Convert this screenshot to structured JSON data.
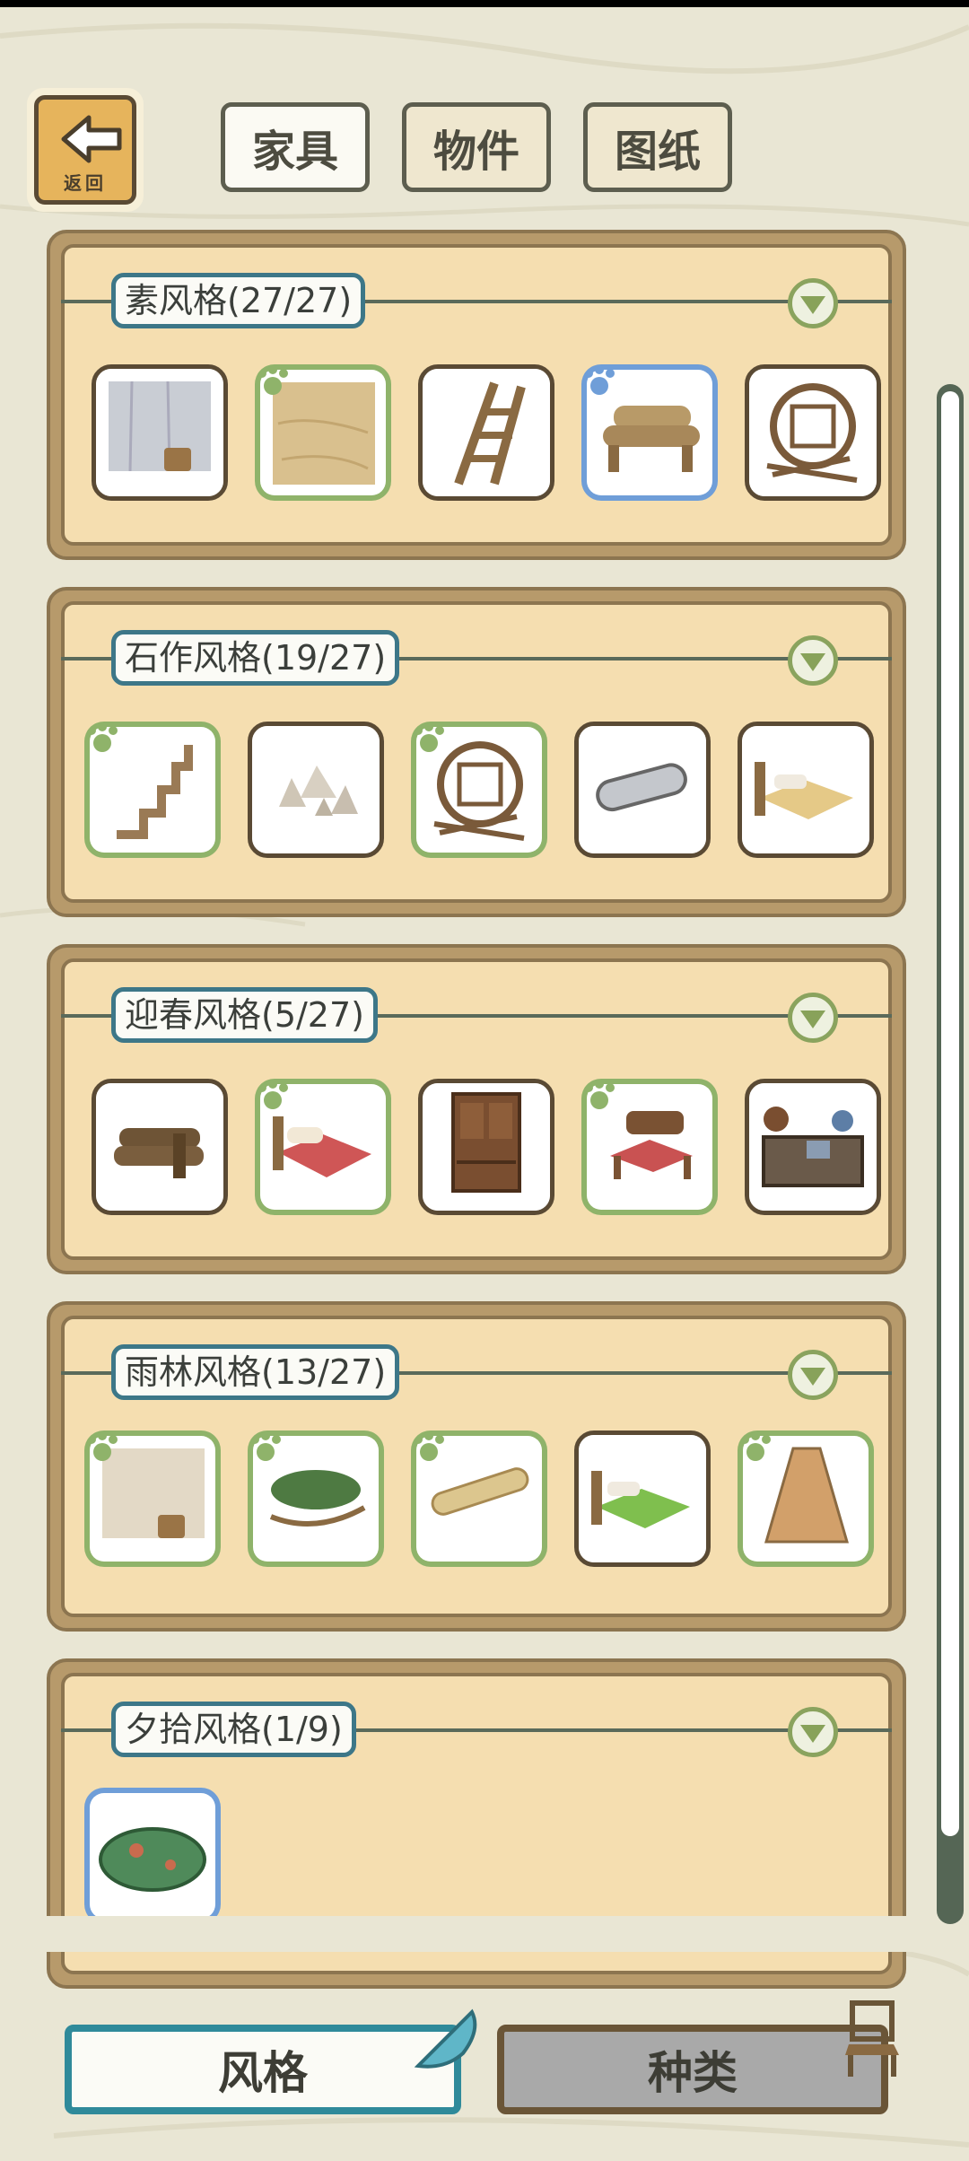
{
  "header": {
    "back_label": "返回",
    "tabs": [
      {
        "label": "家具",
        "active": true
      },
      {
        "label": "物件",
        "active": false
      },
      {
        "label": "图纸",
        "active": false
      }
    ]
  },
  "sections": [
    {
      "title": "素风格(27/27)",
      "items": [
        {
          "name": "gray-wall-bucket",
          "state": "normal"
        },
        {
          "name": "sand-floor",
          "state": "owned"
        },
        {
          "name": "wooden-ladder",
          "state": "normal"
        },
        {
          "name": "log-bench",
          "state": "selected"
        },
        {
          "name": "round-lattice-window",
          "state": "normal"
        }
      ]
    },
    {
      "title": "石作风格(19/27)",
      "items": [
        {
          "name": "stone-stairs",
          "state": "owned"
        },
        {
          "name": "stone-pile",
          "state": "normal"
        },
        {
          "name": "round-lattice-window",
          "state": "owned"
        },
        {
          "name": "stone-roller",
          "state": "normal"
        },
        {
          "name": "golden-bed",
          "state": "normal"
        }
      ]
    },
    {
      "title": "迎春风格(5/27)",
      "items": [
        {
          "name": "log-stack-bench",
          "state": "normal"
        },
        {
          "name": "red-bed",
          "state": "owned"
        },
        {
          "name": "wooden-cabinet",
          "state": "normal"
        },
        {
          "name": "red-chair",
          "state": "owned"
        },
        {
          "name": "stove-kitchen",
          "state": "normal"
        }
      ]
    },
    {
      "title": "雨林风格(13/27)",
      "items": [
        {
          "name": "beige-wall-bucket",
          "state": "owned"
        },
        {
          "name": "leaf-hammock",
          "state": "owned"
        },
        {
          "name": "bamboo-roll",
          "state": "owned"
        },
        {
          "name": "green-bed",
          "state": "normal"
        },
        {
          "name": "wicker-lamp",
          "state": "owned"
        }
      ]
    },
    {
      "title": "夕拾风格(1/9)",
      "items": [
        {
          "name": "green-stone",
          "state": "selected"
        }
      ]
    }
  ],
  "bottom": {
    "style_label": "风格",
    "kind_label": "种类"
  },
  "colors": {
    "background": "#e9e6d4",
    "panel": "#f5deb0",
    "owned": "#8fb36a",
    "selected": "#6f9ed8",
    "label_border": "#3d7788"
  }
}
